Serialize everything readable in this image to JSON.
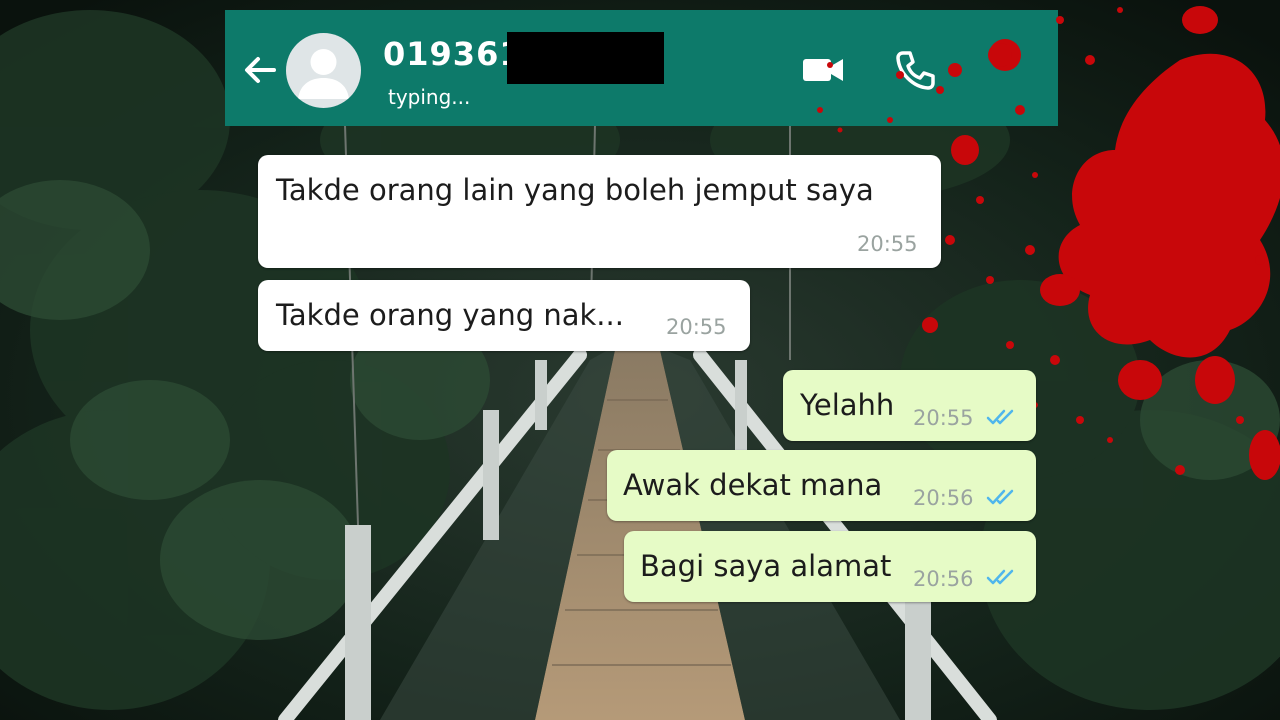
{
  "header": {
    "contact_name": "019361",
    "status": "typing...",
    "colors": {
      "bar": "#0d7a6a",
      "text": "#ffffff"
    }
  },
  "icons": {
    "back": "arrow-left-icon",
    "avatar": "default-avatar-icon",
    "video": "video-camera-icon",
    "call": "phone-icon",
    "read_receipt": "double-check-icon"
  },
  "messages": [
    {
      "direction": "incoming",
      "text": "Takde orang lain yang boleh jemput saya",
      "time": "20:55"
    },
    {
      "direction": "incoming",
      "text": "Takde orang yang nak...",
      "time": "20:55"
    },
    {
      "direction": "outgoing",
      "text": "Yelahh",
      "time": "20:55",
      "status": "read"
    },
    {
      "direction": "outgoing",
      "text": "Awak dekat mana",
      "time": "20:56",
      "status": "read"
    },
    {
      "direction": "outgoing",
      "text": "Bagi saya alamat",
      "time": "20:56",
      "status": "read"
    }
  ],
  "colors": {
    "incoming_bubble": "#ffffff",
    "outgoing_bubble": "#e6fbc6",
    "read_tick": "#4fb6ec",
    "blood": "#c8070a"
  }
}
